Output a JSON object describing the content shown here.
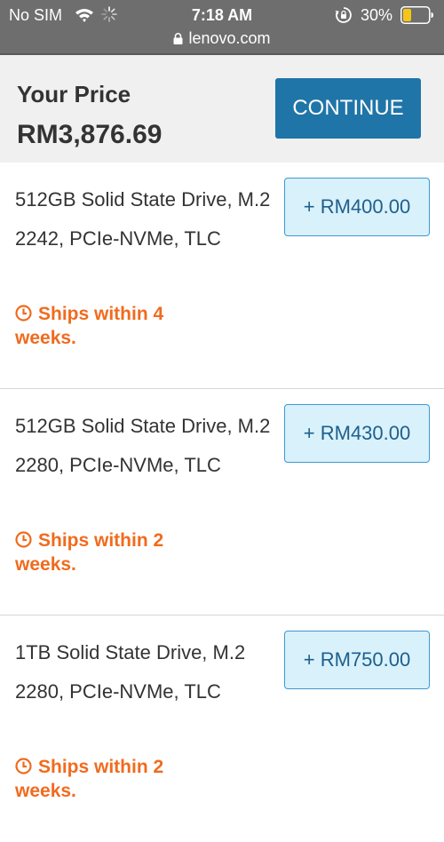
{
  "status_bar": {
    "carrier": "No SIM",
    "time": "7:18 AM",
    "battery": "30%",
    "url": "lenovo.com",
    "icons": [
      "wifi-icon",
      "spinner-icon",
      "rotation-lock-icon",
      "battery-icon",
      "lock-icon"
    ]
  },
  "price_header": {
    "label": "Your Price",
    "value": "RM3,876.69",
    "continue_label": "CONTINUE"
  },
  "options": [
    {
      "description": "512GB Solid State Drive, M.2 2242, PCIe-NVMe, TLC",
      "shipping": "Ships within 4 weeks.",
      "price_label": "+ RM400.00"
    },
    {
      "description": "512GB Solid State Drive, M.2 2280, PCIe-NVMe, TLC",
      "shipping": "Ships within 2 weeks.",
      "price_label": "+ RM430.00"
    },
    {
      "description": "1TB Solid State Drive, M.2 2280, PCIe-NVMe, TLC",
      "shipping": "Ships within 2 weeks.",
      "price_label": "+ RM750.00"
    }
  ],
  "colors": {
    "status_bar_bg": "#6e6e6e",
    "header_bg": "#f0f0f0",
    "continue_bg": "#1f75a8",
    "price_button_bg": "#d8f1fb",
    "price_button_border": "#3d9ad0",
    "shipping_text": "#f06b1e",
    "battery_fill": "#f5c518"
  }
}
